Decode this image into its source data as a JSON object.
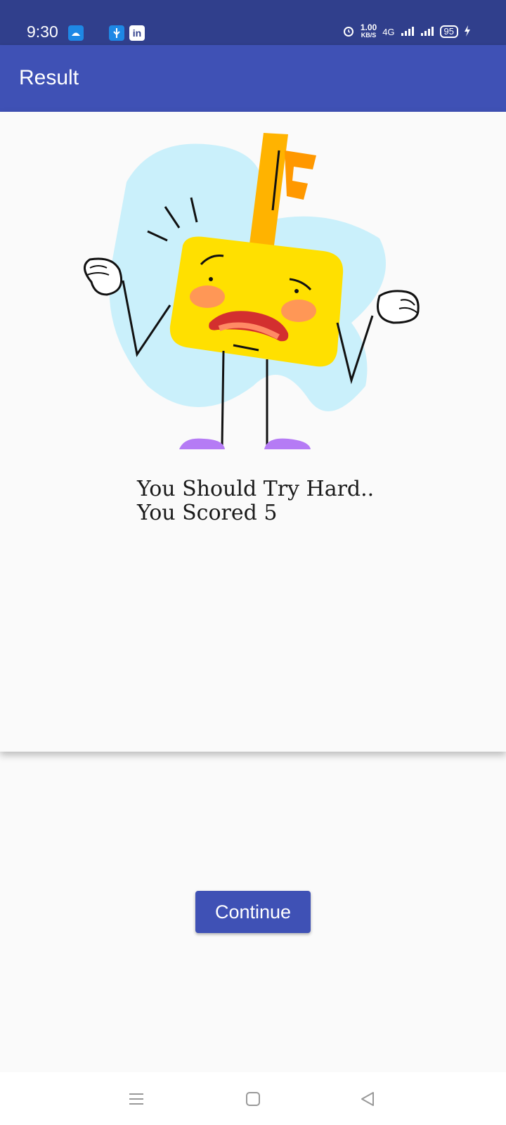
{
  "status_bar": {
    "time": "9:30",
    "speed_value": "1.00",
    "speed_unit": "KB/S",
    "network": "4G",
    "battery": "95"
  },
  "app_bar": {
    "title": "Result"
  },
  "result": {
    "line1": "You Should Try Hard..",
    "line2": "You Scored 5"
  },
  "actions": {
    "continue_label": "Continue"
  },
  "icons": {
    "status_left": [
      "android-debug-icon",
      "usb-icon",
      "linkedin-icon"
    ],
    "status_right": [
      "alarm-icon",
      "signal-icon",
      "battery-icon",
      "charging-icon"
    ],
    "nav": [
      "menu-icon",
      "home-icon",
      "back-icon"
    ]
  }
}
